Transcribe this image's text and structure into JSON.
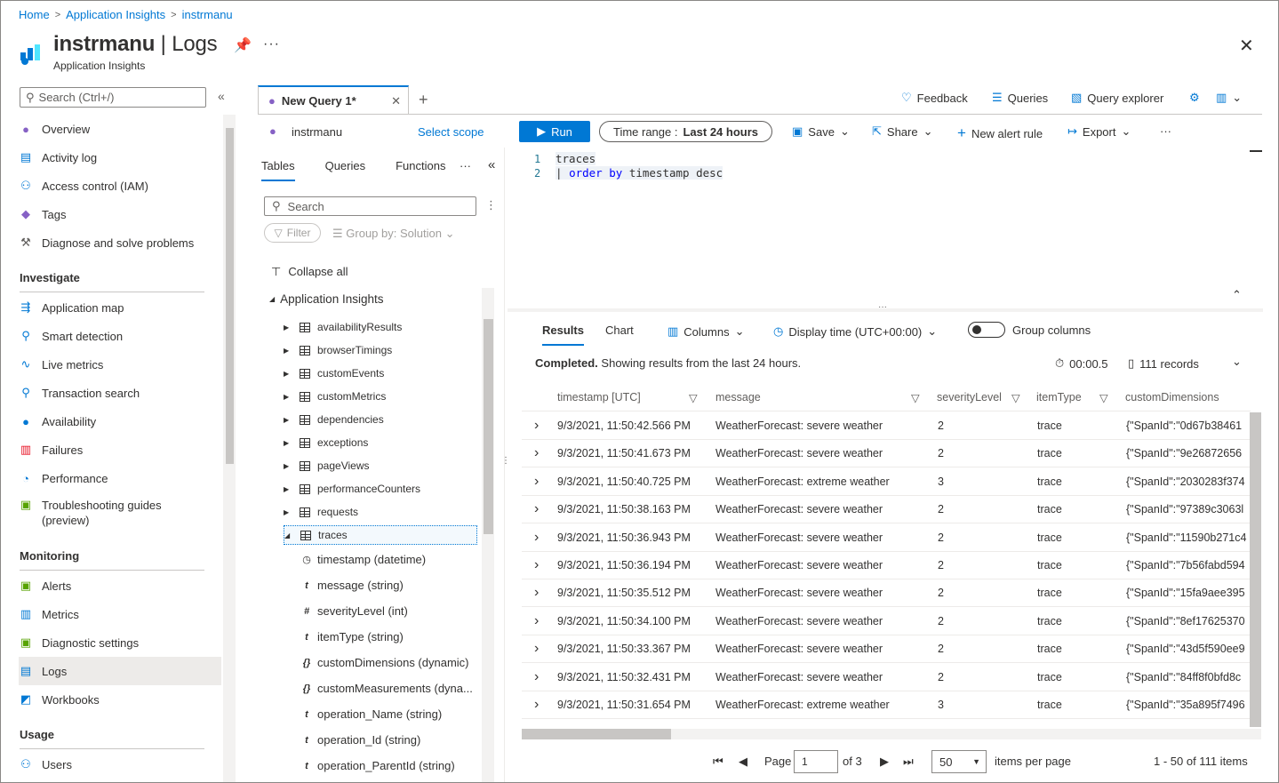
{
  "breadcrumb": [
    "Home",
    "Application Insights",
    "instrmanu"
  ],
  "header": {
    "resource": "instrmanu",
    "page": "Logs",
    "subtitle": "Application Insights"
  },
  "sidebar": {
    "search_placeholder": "Search (Ctrl+/)",
    "top_items": [
      "Overview",
      "Activity log",
      "Access control (IAM)",
      "Tags",
      "Diagnose and solve problems"
    ],
    "sections": [
      {
        "title": "Investigate",
        "items": [
          "Application map",
          "Smart detection",
          "Live metrics",
          "Transaction search",
          "Availability",
          "Failures",
          "Performance",
          "Troubleshooting guides",
          "(preview)"
        ]
      },
      {
        "title": "Monitoring",
        "items": [
          "Alerts",
          "Metrics",
          "Diagnostic settings",
          "Logs",
          "Workbooks"
        ]
      },
      {
        "title": "Usage",
        "items": [
          "Users"
        ]
      }
    ]
  },
  "querytab": {
    "label": "New Query 1*"
  },
  "toolbar_right": {
    "feedback": "Feedback",
    "queries": "Queries",
    "explorer": "Query explorer"
  },
  "scope": {
    "name": "instrmanu",
    "select": "Select scope"
  },
  "run": "Run",
  "timerange": {
    "label": "Time range :",
    "value": "Last 24 hours"
  },
  "actions": {
    "save": "Save",
    "share": "Share",
    "alert": "New alert rule",
    "export": "Export"
  },
  "panel": {
    "tabs": [
      "Tables",
      "Queries",
      "Functions"
    ],
    "search": "Search",
    "filter": "Filter",
    "groupby": "Group by: Solution",
    "collapse": "Collapse all",
    "group": "Application Insights",
    "tables": [
      "availabilityResults",
      "browserTimings",
      "customEvents",
      "customMetrics",
      "dependencies",
      "exceptions",
      "pageViews",
      "performanceCounters",
      "requests",
      "traces"
    ],
    "columns": [
      {
        "sym": "◷",
        "name": "timestamp (datetime)"
      },
      {
        "sym": "t",
        "name": "message (string)"
      },
      {
        "sym": "#",
        "name": "severityLevel (int)"
      },
      {
        "sym": "t",
        "name": "itemType (string)"
      },
      {
        "sym": "{}",
        "name": "customDimensions (dynamic)"
      },
      {
        "sym": "{}",
        "name": "customMeasurements (dyna..."
      },
      {
        "sym": "t",
        "name": "operation_Name (string)"
      },
      {
        "sym": "t",
        "name": "operation_Id (string)"
      },
      {
        "sym": "t",
        "name": "operation_ParentId (string)"
      }
    ]
  },
  "editor": {
    "lines": [
      "1",
      "2"
    ],
    "line1": "traces",
    "line2_pipe": "|",
    "line2_kw1": "order",
    "line2_kw2": "by",
    "line2_rest": "timestamp desc"
  },
  "results": {
    "tabs": [
      "Results",
      "Chart"
    ],
    "columns_btn": "Columns",
    "display_time": "Display time (UTC+00:00)",
    "group_columns": "Group columns",
    "status_bold": "Completed.",
    "status_text": "Showing results from the last 24 hours.",
    "duration": "00:00.5",
    "records": "111 records",
    "headers": [
      "timestamp [UTC]",
      "message",
      "severityLevel",
      "itemType",
      "customDimensions"
    ],
    "rows": [
      [
        "9/3/2021, 11:50:42.566 PM",
        "WeatherForecast: severe weather",
        "2",
        "trace",
        "{\"SpanId\":\"0d67b38461"
      ],
      [
        "9/3/2021, 11:50:41.673 PM",
        "WeatherForecast: severe weather",
        "2",
        "trace",
        "{\"SpanId\":\"9e26872656"
      ],
      [
        "9/3/2021, 11:50:40.725 PM",
        "WeatherForecast: extreme weather",
        "3",
        "trace",
        "{\"SpanId\":\"2030283f374"
      ],
      [
        "9/3/2021, 11:50:38.163 PM",
        "WeatherForecast: severe weather",
        "2",
        "trace",
        "{\"SpanId\":\"97389c3063l"
      ],
      [
        "9/3/2021, 11:50:36.943 PM",
        "WeatherForecast: severe weather",
        "2",
        "trace",
        "{\"SpanId\":\"11590b271c4"
      ],
      [
        "9/3/2021, 11:50:36.194 PM",
        "WeatherForecast: severe weather",
        "2",
        "trace",
        "{\"SpanId\":\"7b56fabd594"
      ],
      [
        "9/3/2021, 11:50:35.512 PM",
        "WeatherForecast: severe weather",
        "2",
        "trace",
        "{\"SpanId\":\"15fa9aee395"
      ],
      [
        "9/3/2021, 11:50:34.100 PM",
        "WeatherForecast: severe weather",
        "2",
        "trace",
        "{\"SpanId\":\"8ef17625370"
      ],
      [
        "9/3/2021, 11:50:33.367 PM",
        "WeatherForecast: severe weather",
        "2",
        "trace",
        "{\"SpanId\":\"43d5f590ee9"
      ],
      [
        "9/3/2021, 11:50:32.431 PM",
        "WeatherForecast: severe weather",
        "2",
        "trace",
        "{\"SpanId\":\"84ff8f0bfd8c"
      ],
      [
        "9/3/2021, 11:50:31.654 PM",
        "WeatherForecast: extreme weather",
        "3",
        "trace",
        "{\"SpanId\":\"35a895f7496"
      ]
    ]
  },
  "pager": {
    "page_label": "Page",
    "page": "1",
    "of": "of 3",
    "per_page": "50",
    "per_page_label": "items per page",
    "range": "1 - 50 of 111 items"
  }
}
